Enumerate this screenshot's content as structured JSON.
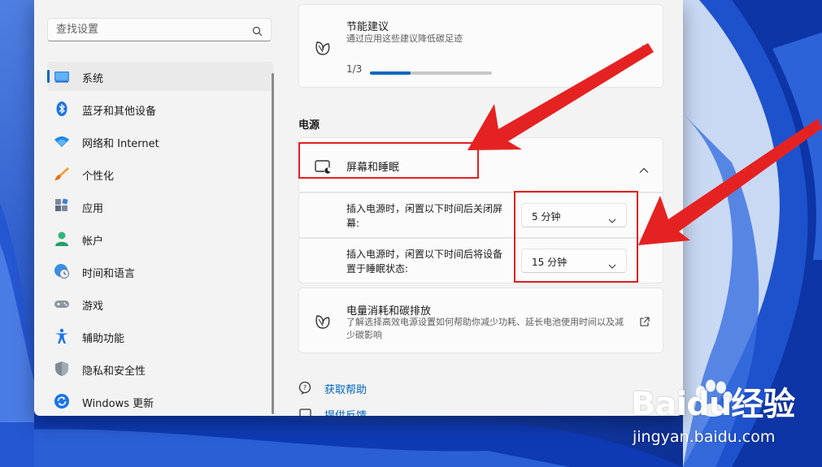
{
  "sidebar": {
    "search_placeholder": "查找设置",
    "items": [
      {
        "label": "系统",
        "icon": "system-display-icon",
        "selected": true
      },
      {
        "label": "蓝牙和其他设备",
        "icon": "bluetooth-icon"
      },
      {
        "label": "网络和 Internet",
        "icon": "wifi-icon"
      },
      {
        "label": "个性化",
        "icon": "paintbrush-icon"
      },
      {
        "label": "应用",
        "icon": "apps-icon"
      },
      {
        "label": "帐户",
        "icon": "account-icon"
      },
      {
        "label": "时间和语言",
        "icon": "globe-clock-icon"
      },
      {
        "label": "游戏",
        "icon": "gamepad-icon"
      },
      {
        "label": "辅助功能",
        "icon": "accessibility-icon"
      },
      {
        "label": "隐私和安全性",
        "icon": "shield-icon"
      },
      {
        "label": "Windows 更新",
        "icon": "windows-update-icon"
      }
    ]
  },
  "main": {
    "energy_card": {
      "title": "节能建议",
      "subtitle": "通过应用这些建议降低碳足迹",
      "progress_text": "1/3",
      "progress_fraction": 0.333
    },
    "section_title": "电源",
    "screen_sleep": {
      "title": "屏幕和睡眠",
      "rows": [
        {
          "text": "插入电源时，闲置以下时间后关闭屏幕:",
          "value": "5 分钟"
        },
        {
          "text": "插入电源时，闲置以下时间后将设备置于睡眠状态:",
          "value": "15 分钟"
        }
      ]
    },
    "power_card": {
      "title": "电量消耗和碳排放",
      "subtitle": "了解选择高效电源设置如何帮助你减少功耗、延长电池使用时间以及减少碳影响"
    },
    "links": {
      "help": "获取帮助",
      "feedback": "提供反馈"
    }
  },
  "watermark": {
    "brand": "Baidu经验",
    "url": "jingyan.baidu.com"
  },
  "colors": {
    "accent": "#0067c0",
    "annotation_red": "#e02020",
    "window_bg": "#f3f3f3",
    "card_bg": "#fbfbfb"
  }
}
